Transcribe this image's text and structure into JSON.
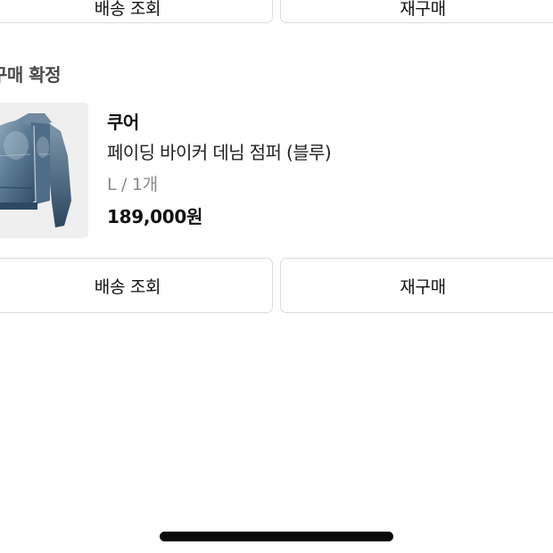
{
  "top_buttons": {
    "left_label": "배송 조회",
    "right_label": "재구매"
  },
  "order": {
    "section_title": "구매 확정",
    "item": {
      "image_icon": "denim-biker-jacket-photo",
      "brand": "쿠어",
      "name": "페이딩 바이커 데님 점퍼 (블루)",
      "option": "L / 1개",
      "price": "189,000원"
    },
    "track_button_label": "배송 조회",
    "rebuy_button_label": "재구매"
  },
  "colors": {
    "border": "#dcdcdc",
    "text": "#111111",
    "muted": "#8a8a8a",
    "thumb_bg": "#efefef",
    "home_indicator": "#0a0a0a"
  }
}
